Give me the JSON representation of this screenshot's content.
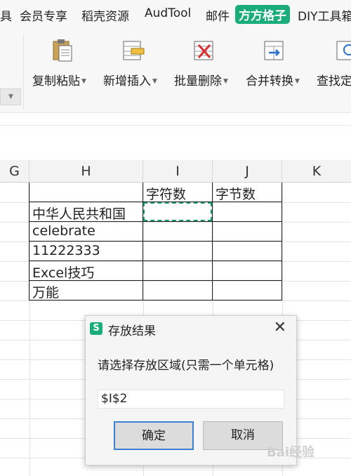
{
  "menubar": {
    "items": [
      "具",
      "会员专享",
      "稻壳资源",
      "AudTool",
      "邮件",
      "方方格子",
      "DIY工具箱"
    ],
    "active_index": 5,
    "accent": "#1aad7a"
  },
  "ribbon": {
    "buttons": [
      {
        "label": "复制粘贴",
        "icon": "clipboard-icon"
      },
      {
        "label": "新增插入",
        "icon": "insert-row-icon"
      },
      {
        "label": "批量删除",
        "icon": "delete-icon"
      },
      {
        "label": "合并转换",
        "icon": "merge-convert-icon"
      },
      {
        "label": "查找定",
        "icon": "find-icon"
      }
    ]
  },
  "sheet": {
    "columns": [
      "G",
      "H",
      "I",
      "J",
      "K"
    ],
    "header_row": [
      "",
      "",
      "字符数",
      "字节数",
      ""
    ],
    "rows": [
      [
        "中华人民共和国",
        "",
        ""
      ],
      [
        "celebrate",
        "",
        ""
      ],
      [
        "11222333",
        "",
        ""
      ],
      [
        "Excel技巧",
        "",
        ""
      ],
      [
        "万能",
        "",
        ""
      ]
    ]
  },
  "dialog": {
    "title": "存放结果",
    "icon_letter": "S",
    "prompt": "请选择存放区域(只需一个单元格)",
    "input_value": "$I$2",
    "ok_label": "确定",
    "cancel_label": "取消",
    "close_glyph": "✕"
  },
  "watermark": "Bai经验"
}
